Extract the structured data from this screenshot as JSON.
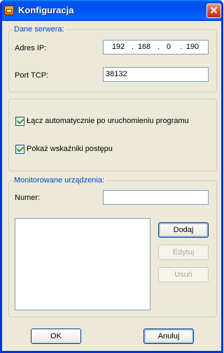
{
  "window": {
    "title": "Konfiguracja",
    "close_glyph": "✕"
  },
  "server": {
    "legend": "Dane serwera:",
    "ip_label": "Adres IP:",
    "ip_octets": [
      "192",
      "168",
      "0",
      "190"
    ],
    "port_label": "Port TCP:",
    "port_value": "38132"
  },
  "options": {
    "auto_connect_label": "Łącz automatycznie po uruchomieniu programu",
    "auto_connect_checked": true,
    "show_progress_label": "Pokaż wskaźniki postępu",
    "show_progress_checked": true
  },
  "devices": {
    "legend": "Monitorowane urządzenia:",
    "number_label": "Numer:",
    "number_value": "",
    "items": [],
    "add_label": "Dodaj",
    "edit_label": "Edytuj",
    "remove_label": "Usuń"
  },
  "footer": {
    "ok_label": "OK",
    "cancel_label": "Anuluj"
  }
}
